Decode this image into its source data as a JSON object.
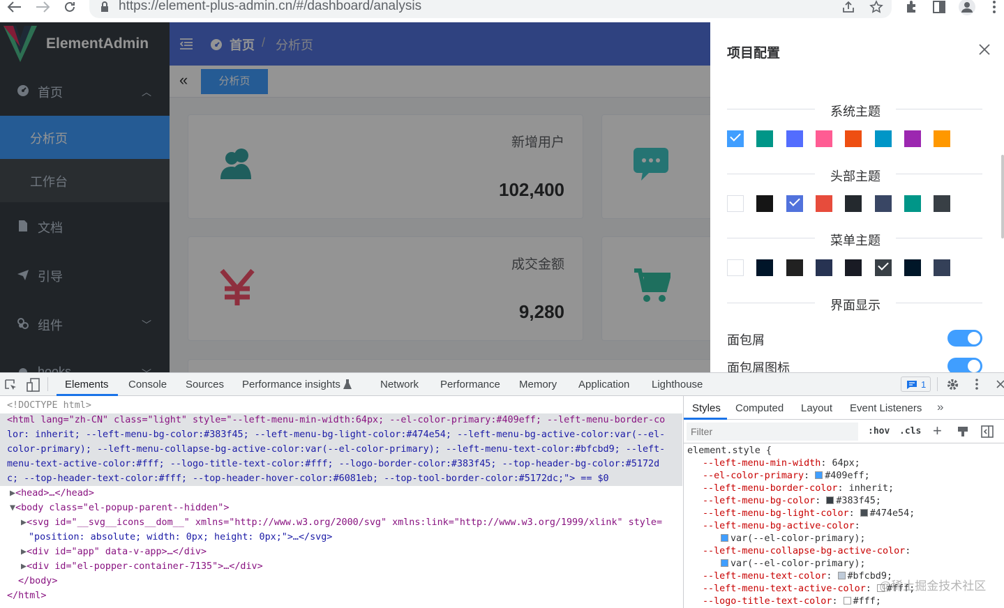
{
  "browser": {
    "url": "https://element-plus-admin.cn/#/dashboard/analysis",
    "back_icon": "arrow-left-icon",
    "forward_icon": "arrow-right-icon",
    "reload_icon": "reload-icon"
  },
  "sidebar": {
    "logo_title": "ElementAdmin",
    "items": [
      {
        "label": "首页",
        "icon": "dashboard-icon",
        "expanded": true
      },
      {
        "label": "分析页",
        "sub": true,
        "active": true
      },
      {
        "label": "工作台",
        "sub": true
      },
      {
        "label": "文档",
        "icon": "document-icon"
      },
      {
        "label": "引导",
        "icon": "send-icon"
      },
      {
        "label": "组件",
        "icon": "component-icon",
        "expandable": true
      },
      {
        "label": "hooks",
        "icon": "hooks-icon",
        "expandable": true
      }
    ],
    "colors": {
      "bg": "#383f45",
      "sub_bg": "#474e54",
      "active": "#409eff"
    }
  },
  "header": {
    "crumb_home": "首页",
    "crumb_sep": "/",
    "crumb_current": "分析页",
    "color": "#5172dc"
  },
  "tags": {
    "active": "分析页"
  },
  "cards": [
    {
      "title": "新增用户",
      "value": "102,400",
      "icon": "users-icon",
      "color": "#36a3a0"
    },
    {
      "title": "成交金额",
      "value": "9,280",
      "icon": "yen-icon",
      "color": "#f4516c"
    },
    {
      "title": "",
      "value": "",
      "icon": "message-icon",
      "color": "#40c9c6"
    },
    {
      "title": "",
      "value": "",
      "icon": "cart-icon",
      "color": "#34bfa3"
    }
  ],
  "drawer": {
    "title": "项目配置",
    "sections": {
      "system_theme": "系统主题",
      "header_theme": "头部主题",
      "menu_theme": "菜单主题",
      "display": "界面显示"
    },
    "system_colors": [
      "#409eff",
      "#009688",
      "#536dfe",
      "#ff5c93",
      "#ee4f12",
      "#0096c7",
      "#9c27b0",
      "#ff9800"
    ],
    "system_selected": 0,
    "header_colors": [
      "#ffffff",
      "#151515",
      "#5172dc",
      "#e74c3c",
      "#24292e",
      "#394664",
      "#009688",
      "#383f45"
    ],
    "header_selected": 2,
    "menu_colors": [
      "#ffffff",
      "#001529",
      "#212121",
      "#273352",
      "#191b24",
      "#383f45",
      "#001628",
      "#344058"
    ],
    "menu_selected": 5,
    "toggles": [
      {
        "label": "面包屑",
        "on": true
      },
      {
        "label": "面包屑图标",
        "on": true
      }
    ]
  },
  "devtools": {
    "tabs": [
      "Elements",
      "Console",
      "Sources",
      "Performance insights",
      "Network",
      "Performance",
      "Memory",
      "Application",
      "Lighthouse"
    ],
    "active_tab": "Elements",
    "issues_count": "1",
    "dom": {
      "doctype": "<!DOCTYPE html>",
      "html_line1": "<html lang=\"zh-CN\" class=\"light\" style=\"--left-menu-min-width:64px; --el-color-primary:#409eff; --left-menu-border-co",
      "html_line2": "lor: inherit; --left-menu-bg-color:#383f45; --left-menu-bg-light-color:#474e54; --left-menu-bg-active-color:var(--el-",
      "html_line3": "color-primary); --left-menu-collapse-bg-active-color:var(--el-color-primary); --left-menu-text-color:#bfcbd9; --left-",
      "html_line4": "menu-text-active-color:#fff; --logo-title-text-color:#fff; --logo-border-color:#383f45; --top-header-bg-color:#5172d",
      "html_line5": "c; --top-header-text-color:#fff; --top-header-hover-color:#6081eb; --top-tool-border-color:#5172dc;\"> == $0",
      "head": "<head>…</head>",
      "body_open": "<body class=\"el-popup-parent--hidden\">",
      "svg_line1": "<svg id=\"__svg__icons__dom__\" xmlns=\"http://www.w3.org/2000/svg\" xmlns:link=\"http://www.w3.org/1999/xlink\" style=",
      "svg_line2": "\"position: absolute; width: 0px; height: 0px;\">…</svg>",
      "app_div": "<div id=\"app\" data-v-app>…</div>",
      "popper_div": "<div id=\"el-popper-container-7135\">…</div>",
      "body_close": "</body>",
      "html_close": "</html>"
    },
    "styles_tabs": [
      "Styles",
      "Computed",
      "Layout",
      "Event Listeners"
    ],
    "filter_placeholder": "Filter",
    "hov": ":hov",
    "cls": ".cls",
    "rule_selector": "element.style {",
    "props": [
      {
        "name": "--left-menu-min-width",
        "value": "64px;"
      },
      {
        "name": "--el-color-primary",
        "value": "#409eff;",
        "swatch": "#409eff"
      },
      {
        "name": "--left-menu-border-color",
        "value": "inherit;"
      },
      {
        "name": "--left-menu-bg-color",
        "value": "#383f45;",
        "swatch": "#383f45"
      },
      {
        "name": "--left-menu-bg-light-color",
        "value": "#474e54;",
        "swatch": "#474e54"
      },
      {
        "name": "--left-menu-bg-active-color",
        "value": ""
      },
      {
        "name": "",
        "value": "var(--el-color-primary);",
        "swatch": "#409eff"
      },
      {
        "name": "--left-menu-collapse-bg-active-color",
        "value": ""
      },
      {
        "name": "",
        "value": "var(--el-color-primary);",
        "swatch": "#409eff"
      },
      {
        "name": "--left-menu-text-color",
        "value": "#bfcbd9;",
        "swatch": "#bfcbd9"
      },
      {
        "name": "--left-menu-text-active-color",
        "value": "#fff;",
        "swatch": "#ffffff"
      },
      {
        "name": "--logo-title-text-color",
        "value": "#fff;",
        "swatch": "#ffffff"
      }
    ]
  },
  "watermark": "@稀土掘金技术社区"
}
